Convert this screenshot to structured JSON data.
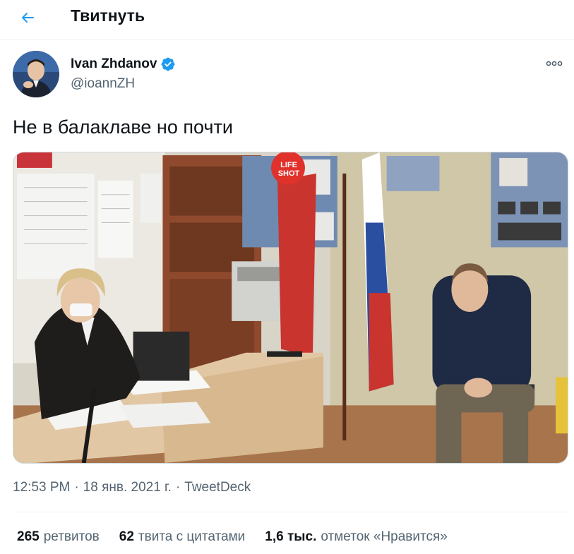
{
  "header": {
    "title": "Твитнуть",
    "back_icon": "arrow-left-icon"
  },
  "tweet": {
    "author": {
      "name": "Ivan Zhdanov",
      "handle": "@ioannZH",
      "verified": true
    },
    "text": "Не в балаклаве но почти",
    "media": {
      "watermark_line1": "LIFE",
      "watermark_line2": "SHOT"
    },
    "meta": {
      "time": "12:53 PM",
      "sep1": "·",
      "date": "18 янв. 2021 г.",
      "sep2": "·",
      "source": "TweetDeck"
    },
    "stats": [
      {
        "count": "265",
        "label": "ретвитов"
      },
      {
        "count": "62",
        "label": "твита с цитатами"
      },
      {
        "count": "1,6 тыс.",
        "label": "отметок «Нравится»"
      }
    ]
  },
  "colors": {
    "accent": "#1d9bf0",
    "text": "#0f1419",
    "secondary": "#536471",
    "border": "#eff3f4"
  }
}
